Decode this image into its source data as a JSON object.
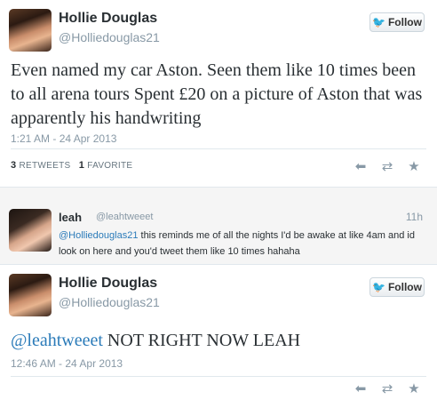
{
  "tweet1": {
    "name": "Hollie Douglas",
    "handle": "@Holliedouglas21",
    "follow_label": "Follow",
    "text": "Even named my car Aston. Seen them like 10 times been to all arena tours Spent £20 on a picture of Aston that was apparently his handwriting",
    "timestamp": "1:21 AM - 24 Apr 2013",
    "retweets_count": "3",
    "retweets_label": "RETWEETS",
    "favorites_count": "1",
    "favorites_label": "FAVORITE",
    "actions": {
      "reply_icon": "reply-icon",
      "retweet_icon": "retweet-icon",
      "favorite_icon": "favorite-icon"
    }
  },
  "reply": {
    "name": "leah",
    "handle": "@leahtweeet",
    "time": "11h",
    "mention": "@Holliedouglas21",
    "text": " this reminds me of all the nights I'd be awake at like 4am and id look on here and you'd tweet them like 10 times hahaha"
  },
  "tweet2": {
    "name": "Hollie Douglas",
    "handle": "@Holliedouglas21",
    "follow_label": "Follow",
    "mention": "@leahtweeet",
    "text": " NOT RIGHT NOW LEAH",
    "timestamp": "12:46 AM - 24 Apr 2013"
  },
  "colors": {
    "link": "#2b7bb9",
    "twitter_blue": "#2aa9e0",
    "meta_gray": "#8899a6"
  }
}
